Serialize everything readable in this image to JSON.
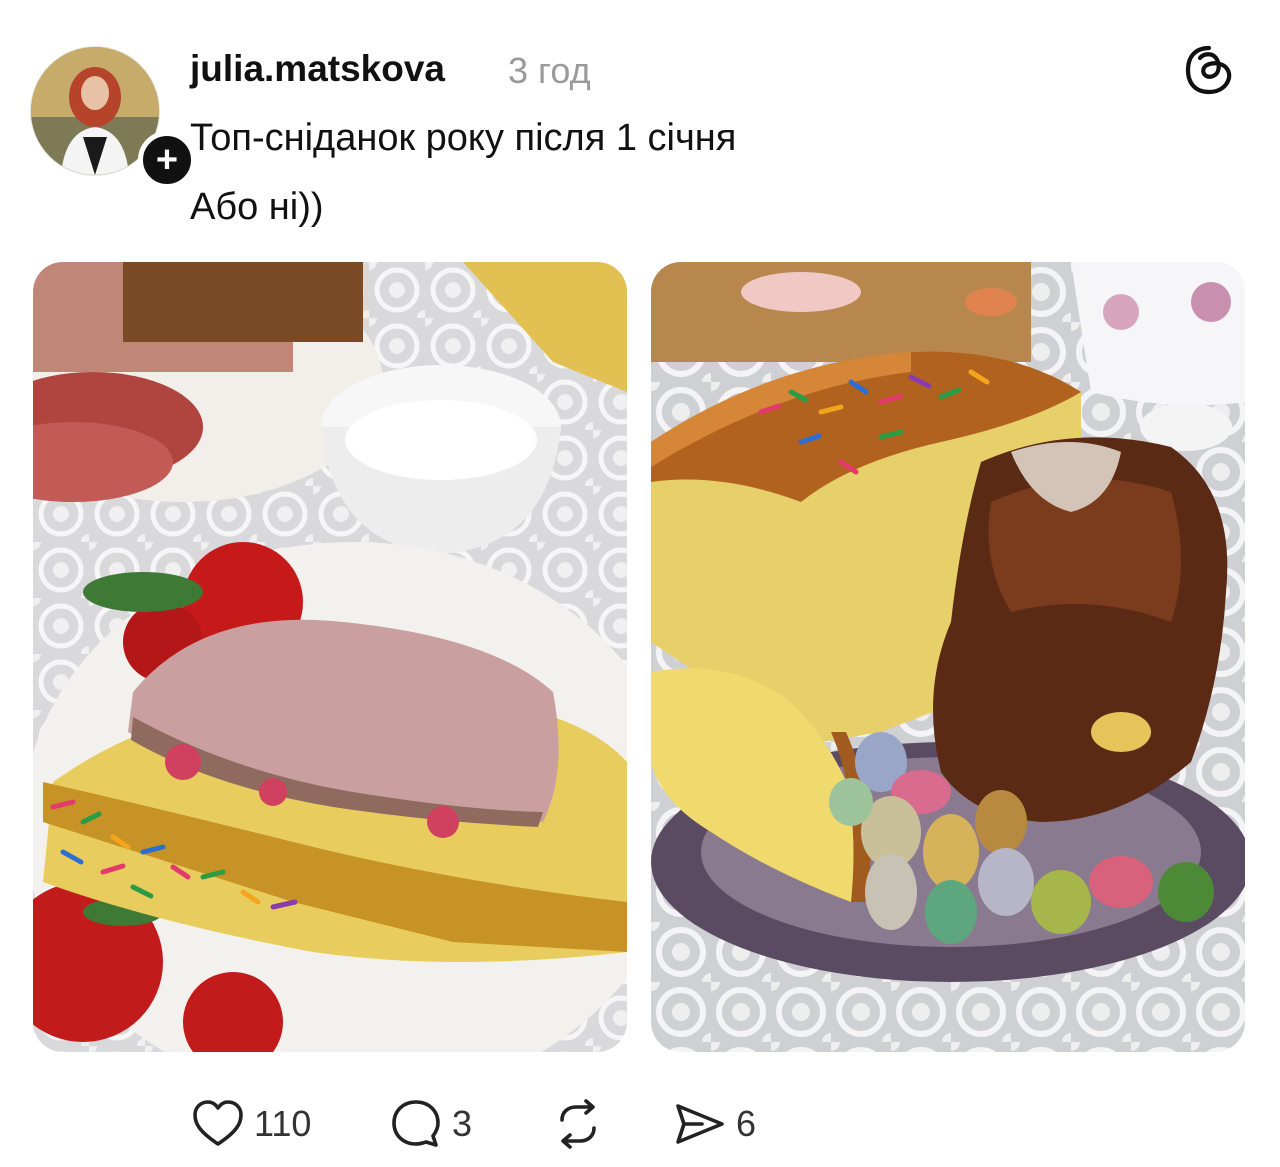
{
  "post": {
    "username": "julia.matskova",
    "time_ago": "3 год",
    "caption_line1": "Топ-сніданок року після 1 січня",
    "caption_line2": "Або ні))",
    "follow_symbol": "+"
  },
  "images": [
    {
      "subject": "ham-on-easter-bread-photo"
    },
    {
      "subject": "easter-breads-with-chocolate-eggs-photo"
    }
  ],
  "actions": {
    "like_count": "110",
    "comment_count": "3",
    "share_count": "6"
  },
  "icons": {
    "app": "threads-icon",
    "like": "heart-icon",
    "comment": "comment-bubble-icon",
    "repost": "repost-icon",
    "share": "send-icon",
    "follow": "plus-icon"
  },
  "colors": {
    "text": "#111111",
    "muted": "#9a9a9a",
    "background": "#ffffff"
  }
}
